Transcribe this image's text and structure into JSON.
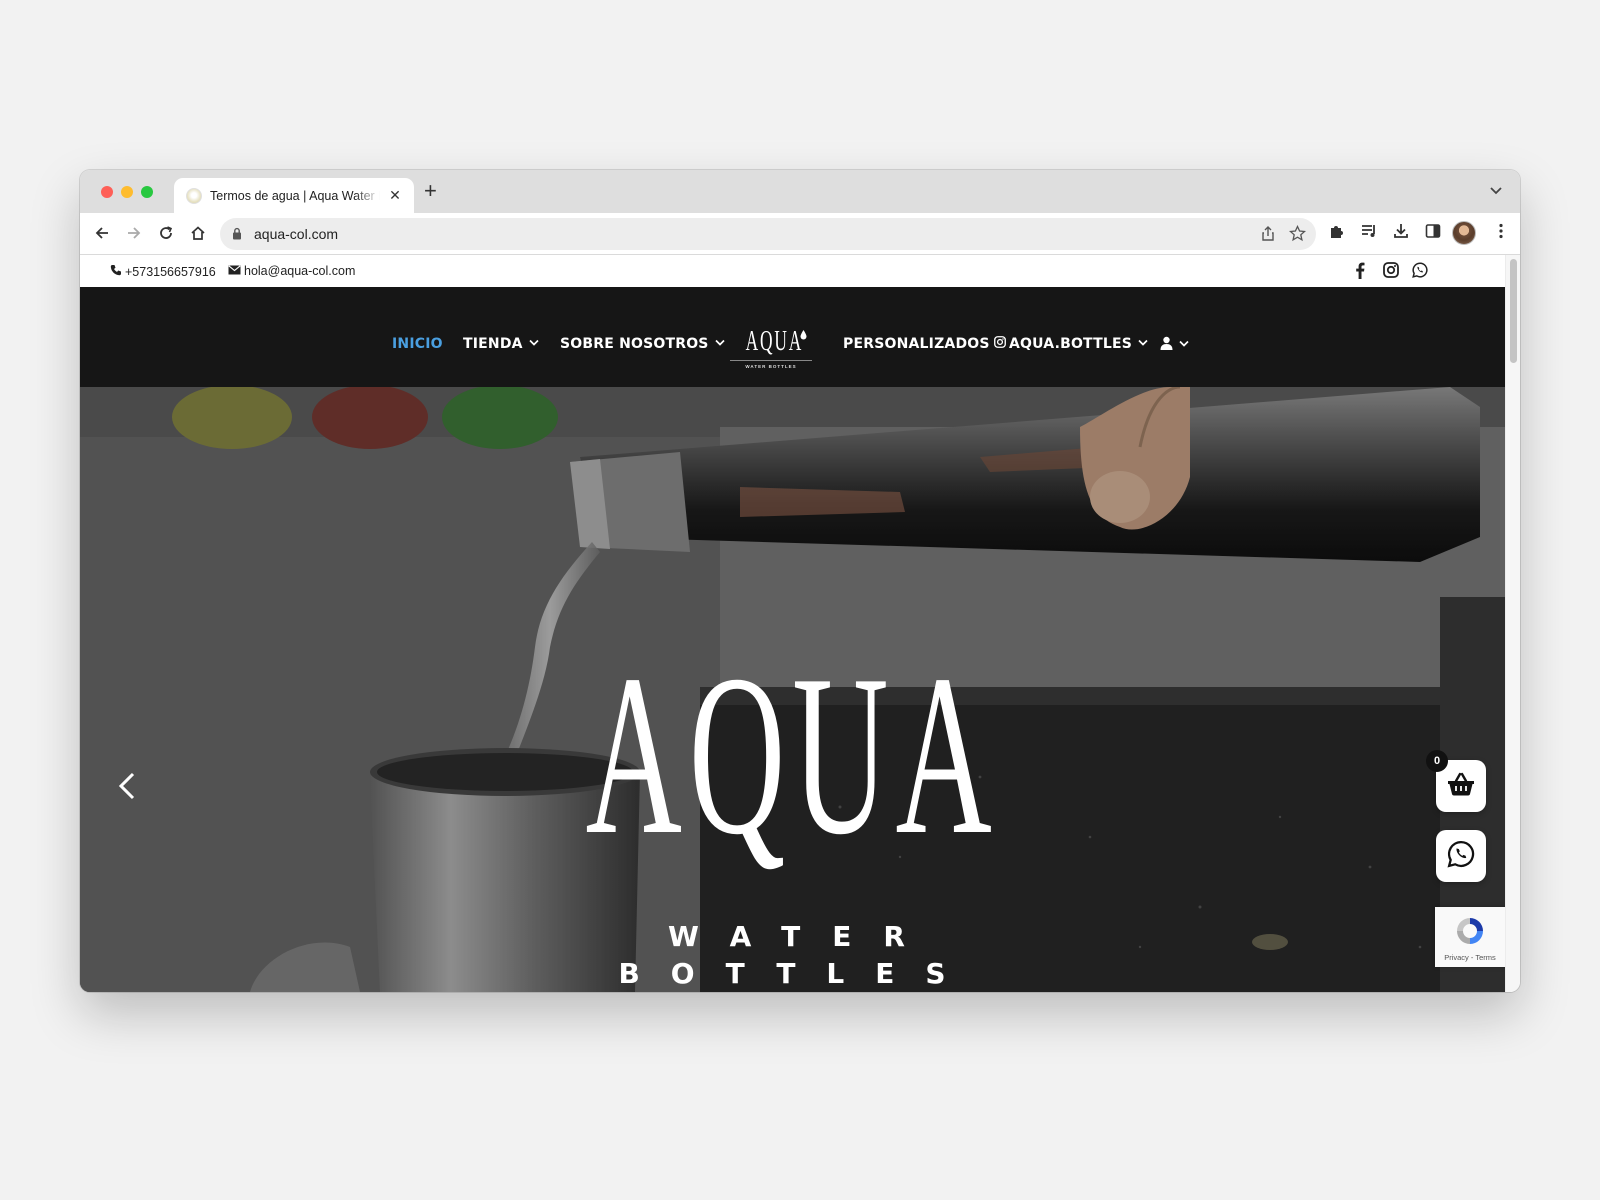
{
  "browser": {
    "tab_title": "Termos de agua | Aqua Water Bottles",
    "new_tab_label": "+",
    "url": "aqua-col.com"
  },
  "topbar": {
    "phone": "+573156657916",
    "email": "hola@aqua-col.com",
    "social_icons": [
      "facebook-icon",
      "instagram-icon",
      "whatsapp-icon"
    ]
  },
  "nav": {
    "items": [
      {
        "label": "INICIO",
        "active": true
      },
      {
        "label": "TIENDA",
        "dropdown": true
      },
      {
        "label": "SOBRE NOSOTROS",
        "dropdown": true
      },
      {
        "label": "PERSONALIZADOS"
      },
      {
        "label": "AQUA.BOTTLES",
        "dropdown": true
      }
    ],
    "logo_word": "AQUA",
    "logo_sub": "WATER BOTTLES"
  },
  "hero": {
    "title": "AQUA",
    "subtitle_line1": "WATER",
    "subtitle_line2": "BOTTLES"
  },
  "cart": {
    "count": "0"
  },
  "recaptcha": {
    "text": "Privacy - Terms"
  },
  "colors": {
    "nav_active": "#4a9fe0",
    "nav_bg": "#161616"
  }
}
